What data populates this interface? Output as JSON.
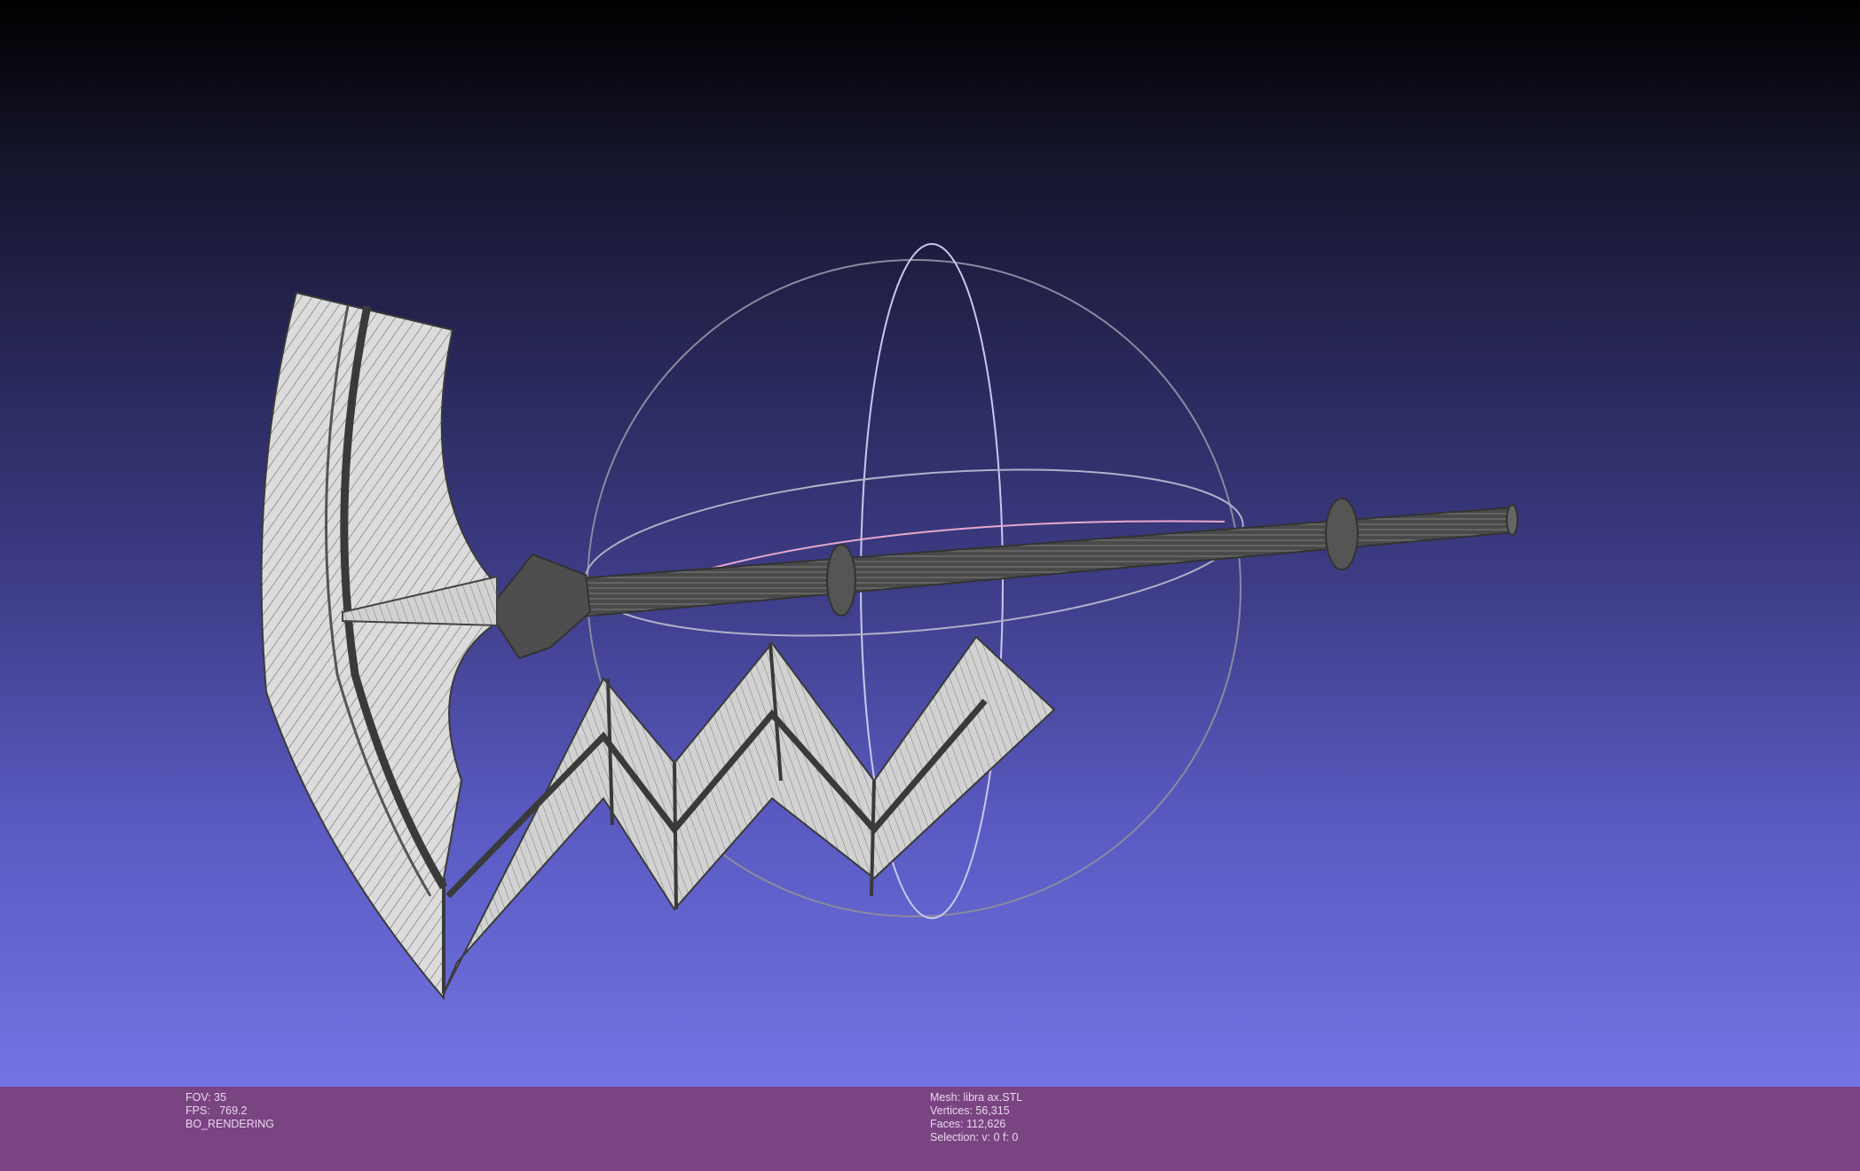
{
  "app": "MeshLab",
  "viewport": {
    "background_top": "#000000",
    "background_bottom": "#7373e4",
    "mesh_fill": "#d4d4d4",
    "wire_color": "#3c3c3c",
    "trackball_color": "#9a9ab0"
  },
  "info_left": {
    "fov": "FOV: 35",
    "fps": "FPS:   769.2",
    "mode": "BO_RENDERING"
  },
  "info_right": {
    "mesh": "Mesh: libra ax.STL",
    "vertices": "Vertices: 56,315",
    "faces": "Faces: 112,626",
    "selection": "Selection: v: 0 f: 0"
  },
  "infobar_color": "#7a4482"
}
